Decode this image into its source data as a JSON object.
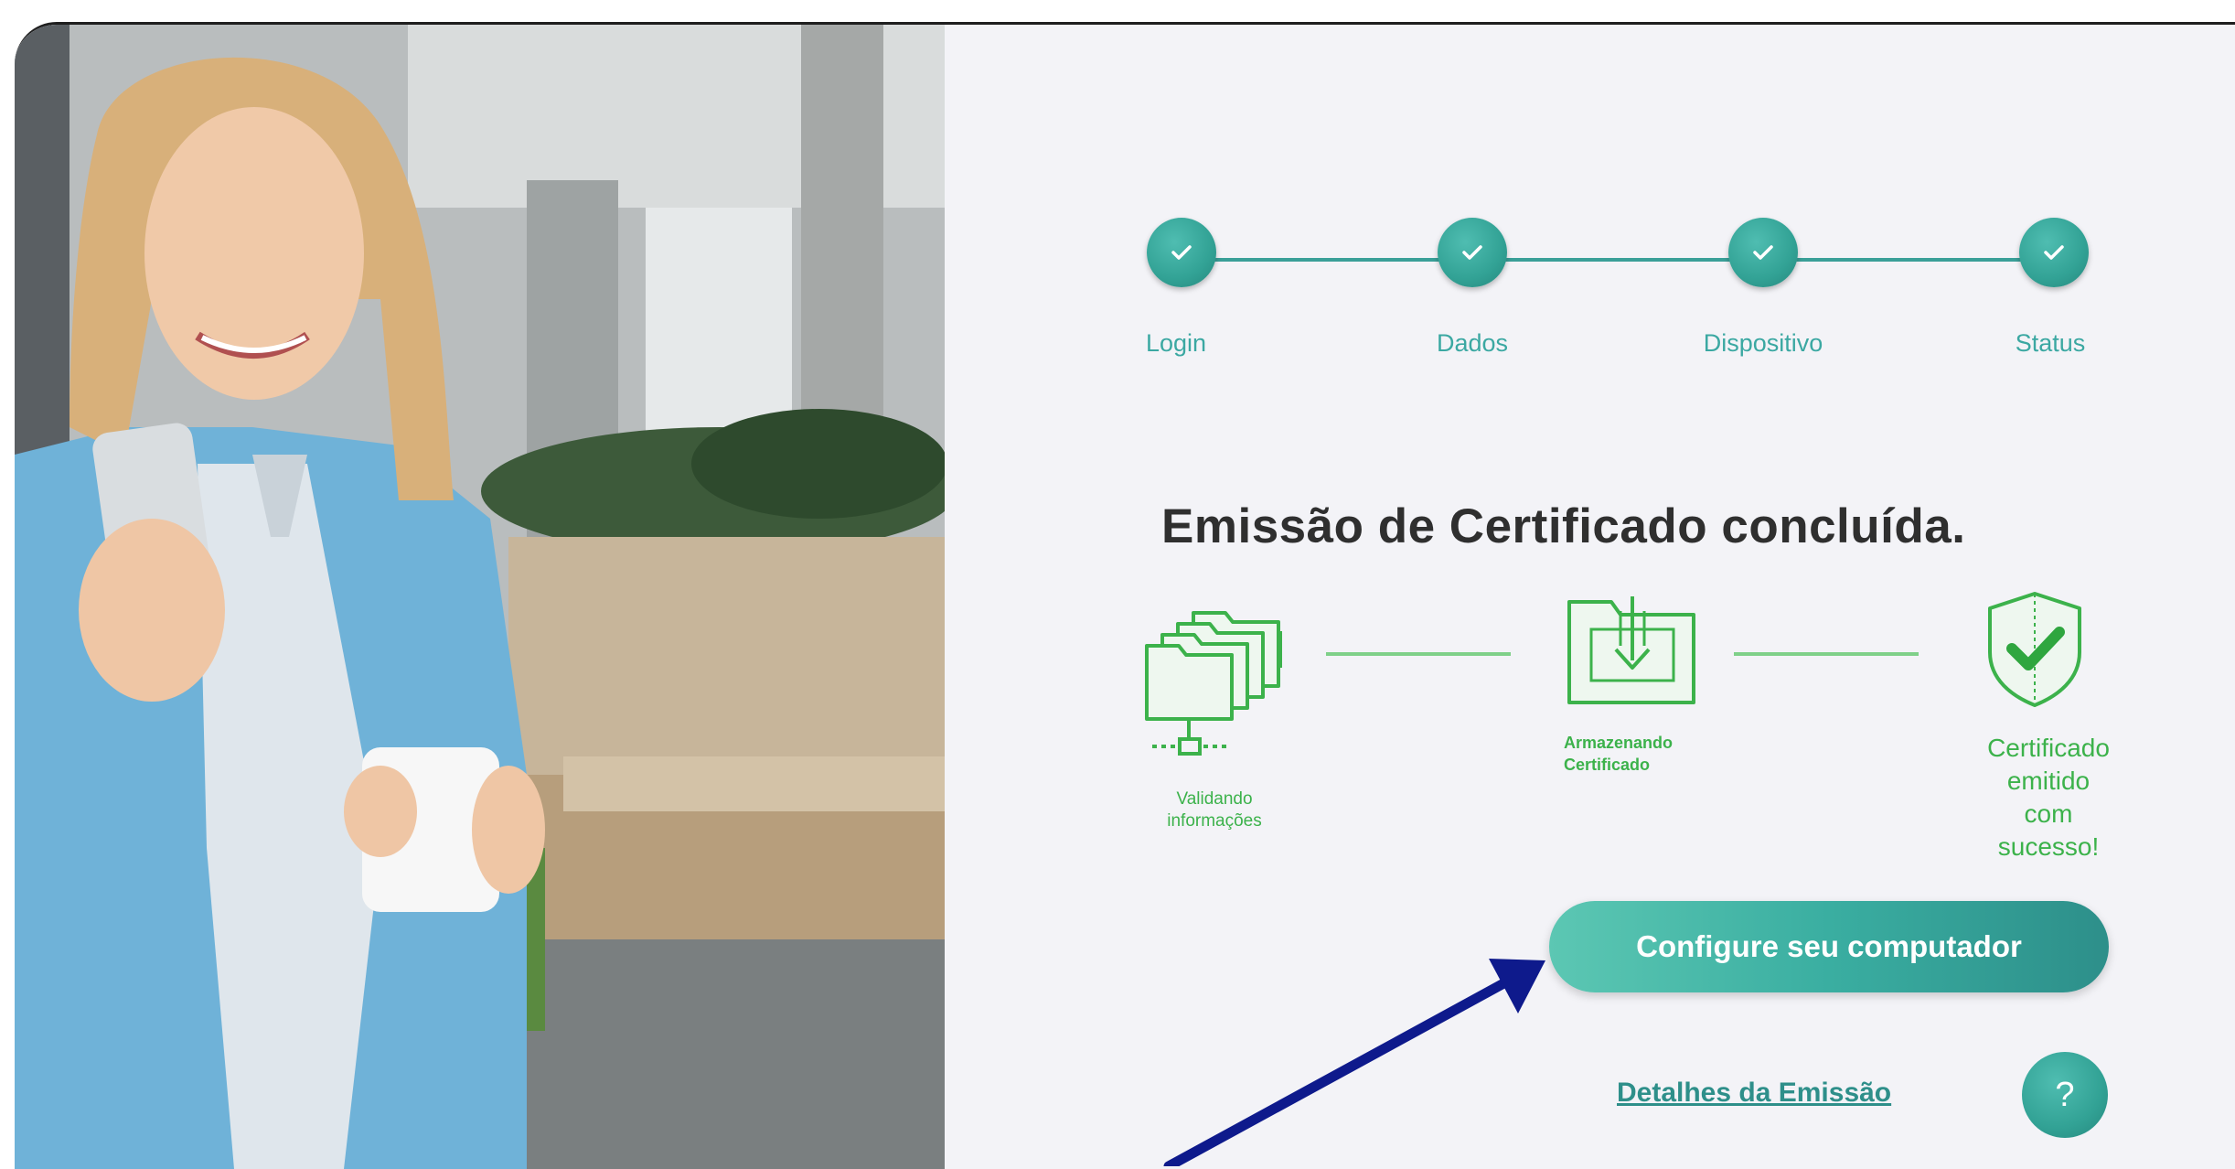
{
  "steps": [
    {
      "label": "Login",
      "done": true
    },
    {
      "label": "Dados",
      "done": true
    },
    {
      "label": "Dispositivo",
      "done": true
    },
    {
      "label": "Status",
      "done": true
    }
  ],
  "title": "Emissão de Certificado concluída.",
  "process": [
    {
      "label_line1": "Validando",
      "label_line2": "informações",
      "icon": "folders-network-icon"
    },
    {
      "label_line1": "Armazenando",
      "label_line2": "Certificado",
      "icon": "folder-download-icon"
    },
    {
      "label_line1": "Certificado",
      "label_line2": "emitido",
      "label_line3": "com",
      "label_line4": "sucesso!",
      "icon": "shield-check-icon"
    }
  ],
  "cta_label": "Configure seu computador",
  "details_link": "Detalhes da Emissão",
  "help_label": "?",
  "colors": {
    "teal": "#32a295",
    "green": "#3cb24b",
    "arrow": "#0e1a8c"
  }
}
